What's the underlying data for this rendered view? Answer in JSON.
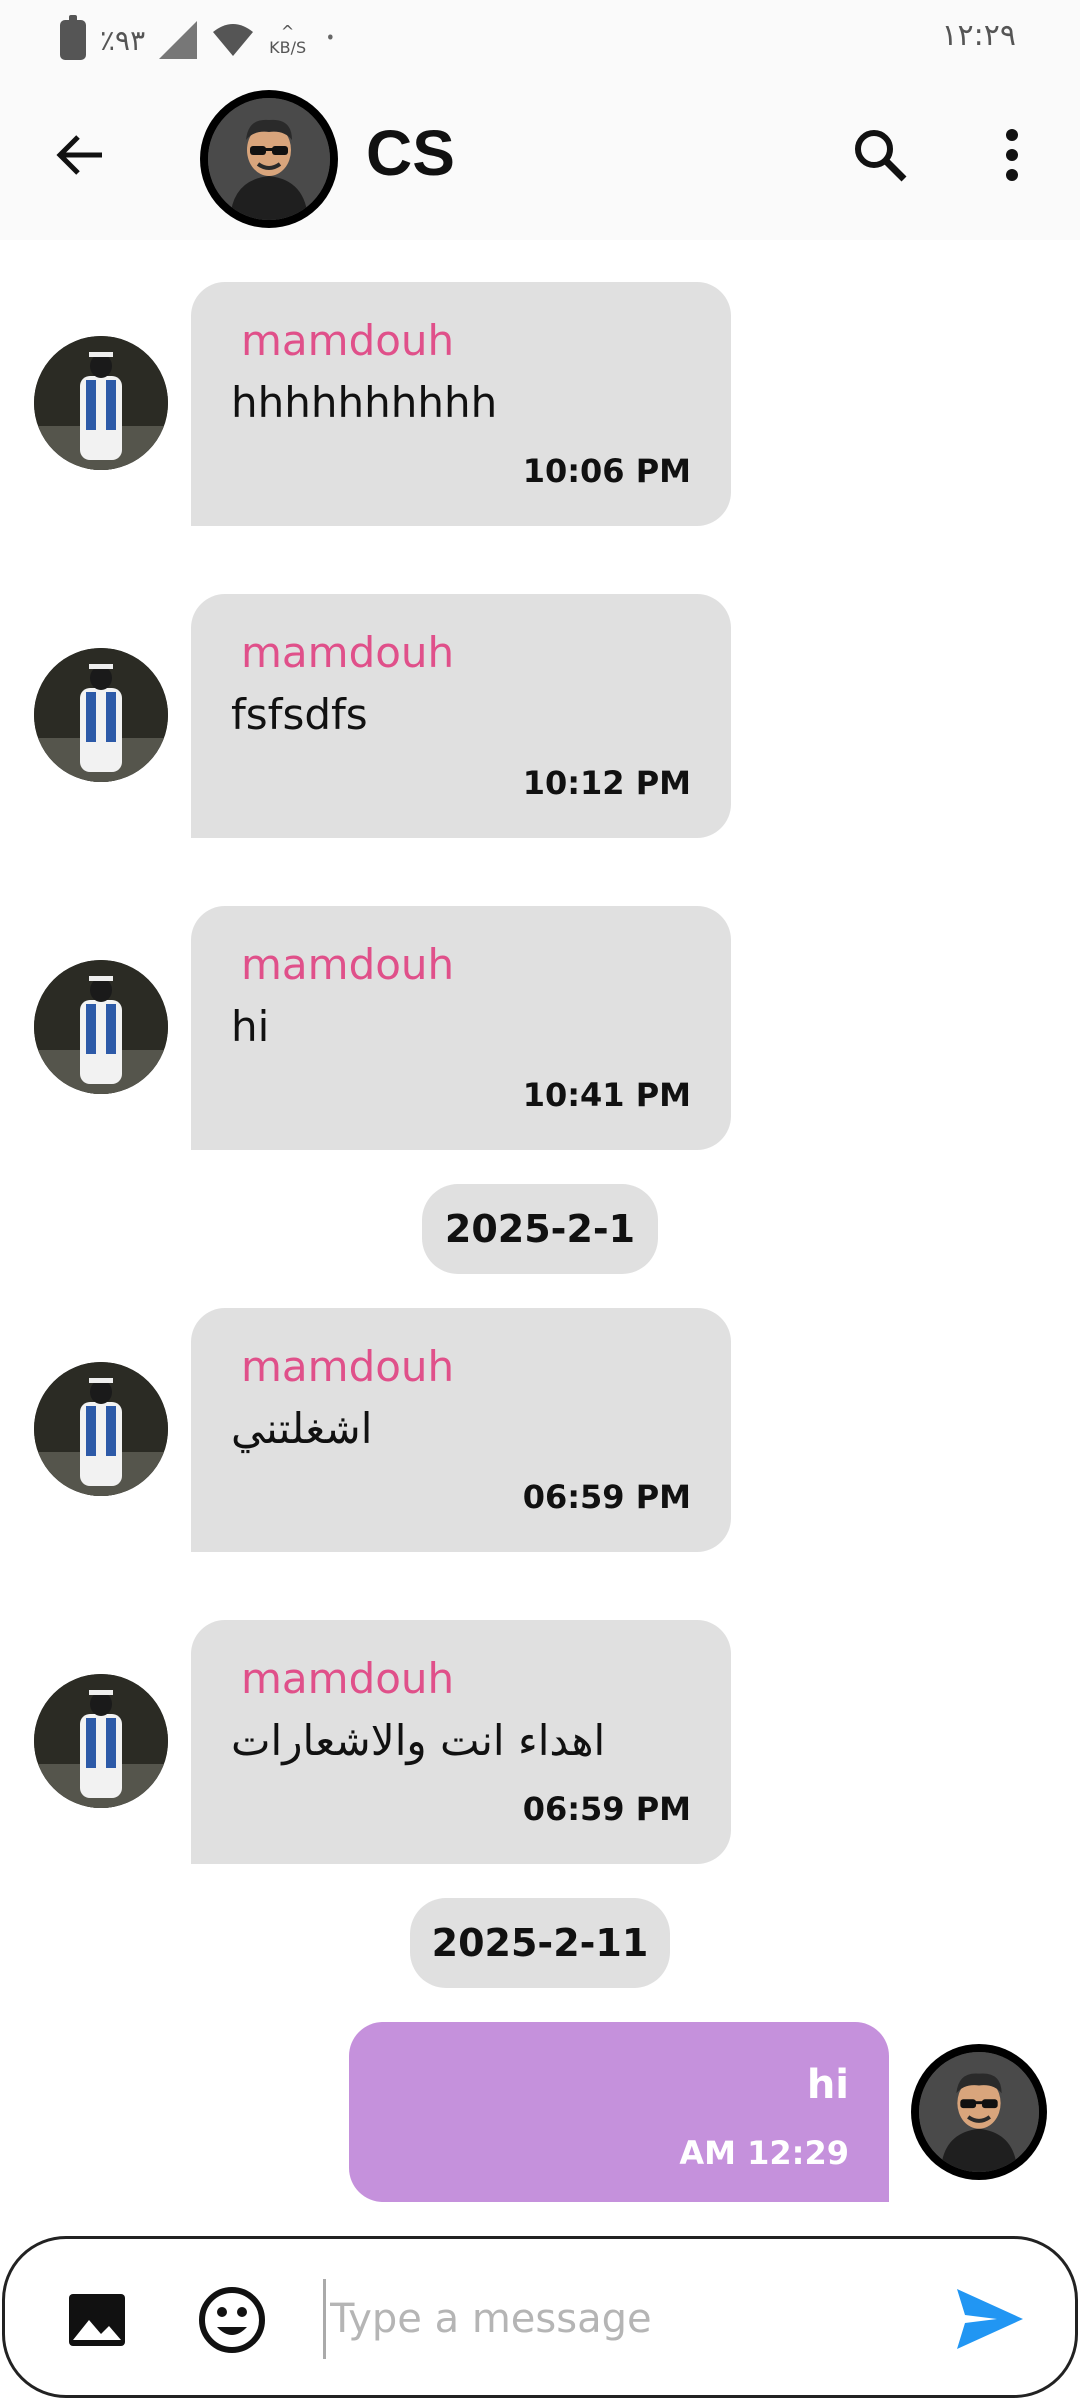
{
  "status_bar": {
    "battery": "٪٩٣",
    "speed_unit": "KB/S",
    "time": "١٢:٢٩"
  },
  "header": {
    "title": "CS",
    "icons": [
      "back-arrow-icon",
      "search-icon",
      "more-vert-icon"
    ]
  },
  "colors": {
    "sender": "#e0508a",
    "incoming_bubble": "#e0e0e0",
    "outgoing_bubble": "#c591dc",
    "send_icon": "#2196f3"
  },
  "messages": [
    {
      "sender": "mamdouh",
      "text": "hhhhhhhhhh",
      "time": "10:06 PM"
    },
    {
      "sender": "mamdouh",
      "text": "fsfsdfs",
      "time": "10:12 PM"
    },
    {
      "sender": "mamdouh",
      "text": "hi",
      "time": "10:41 PM"
    },
    {
      "sender": "mamdouh",
      "text": "اشغلتني",
      "time": "06:59 PM"
    },
    {
      "sender": "mamdouh",
      "text": "اهداء انت والاشعارات",
      "time": "06:59 PM"
    }
  ],
  "dates": [
    "2025-2-1",
    "2025-2-11"
  ],
  "outgoing": {
    "text": "hi",
    "time": "AM 12:29"
  },
  "composer": {
    "placeholder": "Type a message",
    "icons": [
      "image-icon",
      "emoji-icon",
      "send-icon"
    ]
  }
}
